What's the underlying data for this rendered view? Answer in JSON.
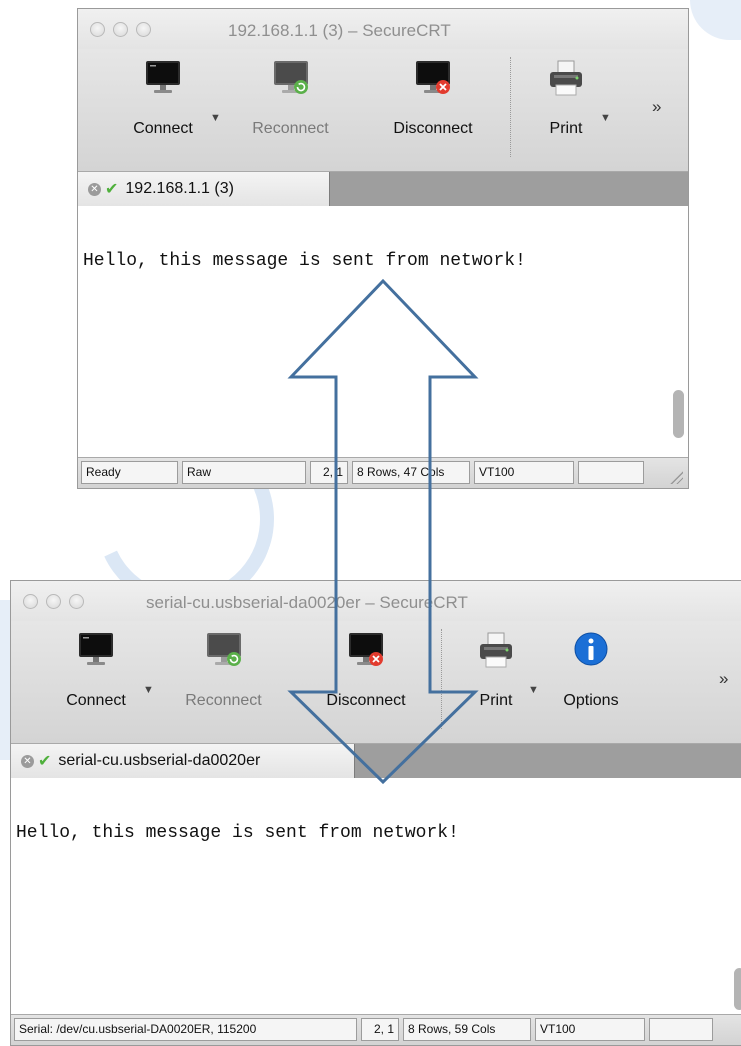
{
  "window_top": {
    "title": "192.168.1.1 (3) – SecureCRT",
    "toolbar": {
      "connect": "Connect",
      "reconnect": "Reconnect",
      "disconnect": "Disconnect",
      "print": "Print",
      "dropdown_glyph": "▼",
      "more_glyph": "»"
    },
    "tab": {
      "close_glyph": "✕",
      "check_glyph": "✔",
      "label": "192.168.1.1 (3)"
    },
    "terminal_text": "Hello, this message is sent from network!",
    "status": {
      "state": "Ready",
      "mode": "Raw",
      "cursor": "2, 1",
      "size": "8 Rows, 47 Cols",
      "emulation": "VT100",
      "extra": ""
    }
  },
  "window_bottom": {
    "title": "serial-cu.usbserial-da0020er – SecureCRT",
    "toolbar": {
      "connect": "Connect",
      "reconnect": "Reconnect",
      "disconnect": "Disconnect",
      "print": "Print",
      "options": "Options",
      "dropdown_glyph": "▼",
      "more_glyph": "»"
    },
    "tab": {
      "close_glyph": "✕",
      "check_glyph": "✔",
      "label": "serial-cu.usbserial-da0020er"
    },
    "terminal_text": "Hello, this message is sent from network!",
    "status": {
      "state": "Serial: /dev/cu.usbserial-DA0020ER, 115200",
      "cursor": "2, 1",
      "size": "8 Rows, 59 Cols",
      "emulation": "VT100",
      "extra": ""
    }
  },
  "icons": {
    "connect": "monitor-icon",
    "reconnect": "monitor-reconnect-icon",
    "disconnect": "monitor-disconnect-icon",
    "print": "printer-icon",
    "options": "info-icon"
  },
  "colors": {
    "arrow_stroke": "#44709e",
    "check_green": "#4fb03c",
    "disconnect_red": "#e23b2e",
    "reconnect_green": "#5bb04a",
    "options_blue": "#1b6fd6"
  }
}
